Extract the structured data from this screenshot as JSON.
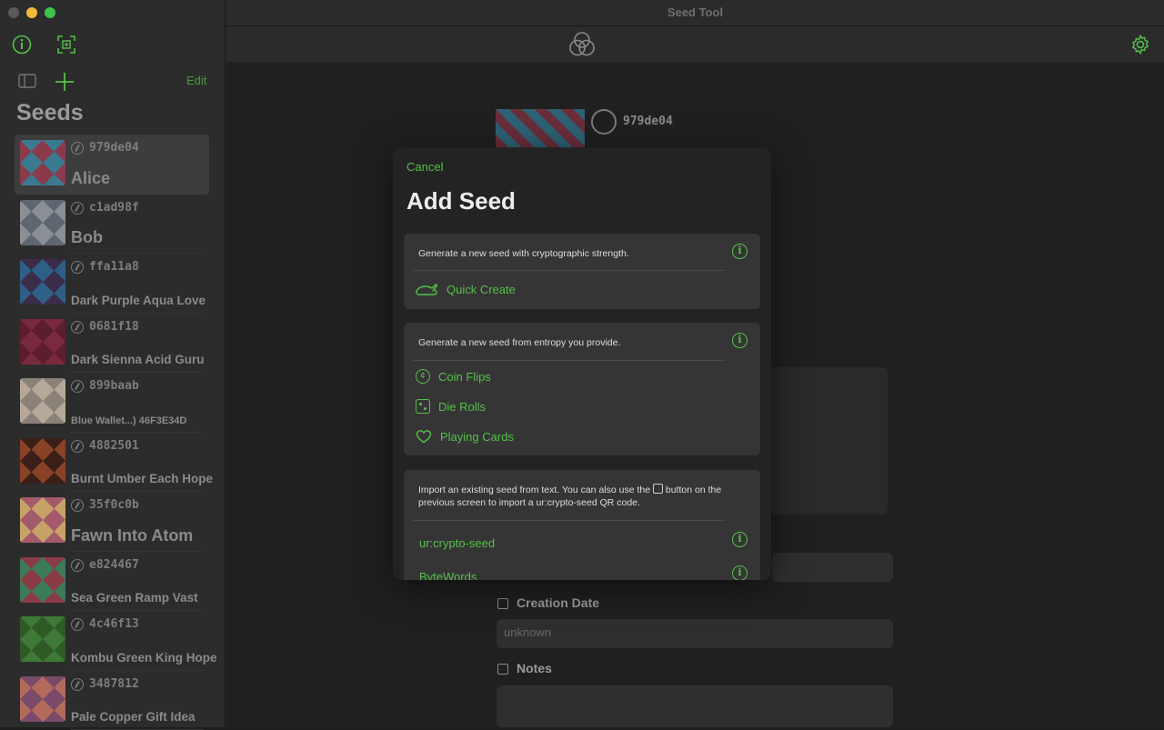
{
  "window": {
    "title": "Seed Tool"
  },
  "sidebar": {
    "title": "Seeds",
    "edit_label": "Edit",
    "seeds": [
      {
        "id": "979de04",
        "name": "Alice",
        "size": "lg",
        "colors": [
          "#8a3a4a",
          "#3a7a90"
        ],
        "selected": true
      },
      {
        "id": "c1ad98f",
        "name": "Bob",
        "size": "lg",
        "colors": [
          "#8a8f96",
          "#5e6670"
        ]
      },
      {
        "id": "ffa11a8",
        "name": "Dark Purple Aqua Love",
        "size": "md",
        "colors": [
          "#2e5f86",
          "#3b2d4a"
        ]
      },
      {
        "id": "0681f18",
        "name": "Dark Sienna Acid Guru",
        "size": "md",
        "colors": [
          "#5c1e2c",
          "#7a2a3e"
        ]
      },
      {
        "id": "899baab",
        "name": "Blue Wallet...) 46F3E34D",
        "size": "sm",
        "colors": [
          "#b6a898",
          "#8a8278"
        ]
      },
      {
        "id": "4882501",
        "name": "Burnt Umber Each Hope",
        "size": "md",
        "colors": [
          "#8a4226",
          "#3a1e18"
        ]
      },
      {
        "id": "35f0c0b",
        "name": "Fawn Into Atom",
        "size": "lg",
        "colors": [
          "#c7a268",
          "#a35a6a"
        ]
      },
      {
        "id": "e824467",
        "name": "Sea Green Ramp Vast",
        "size": "md",
        "colors": [
          "#3c7a5a",
          "#8a3a44"
        ]
      },
      {
        "id": "4c46f13",
        "name": "Kombu Green King Hope",
        "size": "md",
        "colors": [
          "#2e5a26",
          "#3e7a36"
        ]
      },
      {
        "id": "3487812",
        "name": "Pale Copper Gift Idea",
        "size": "md",
        "colors": [
          "#b36a5a",
          "#7a4a6a"
        ]
      }
    ]
  },
  "detail": {
    "seed_id": "979de04",
    "creation_date_label": "Creation Date",
    "creation_date_value": "unknown",
    "notes_label": "Notes"
  },
  "modal": {
    "cancel_label": "Cancel",
    "title": "Add Seed",
    "card1": {
      "description": "Generate a new seed with cryptographic strength.",
      "option": "Quick Create"
    },
    "card2": {
      "description": "Generate a new seed from entropy you provide.",
      "options": [
        "Coin Flips",
        "Die Rolls",
        "Playing Cards"
      ]
    },
    "card3": {
      "description_before": "Import an existing seed from text. You can also use the ",
      "description_after": " button on the previous screen to import a ur:crypto-seed QR code.",
      "options": [
        "ur:crypto-seed",
        "ByteWords"
      ]
    }
  },
  "colors": {
    "accent": "#55c04a",
    "modal_bg": "#232323",
    "card_bg": "#353535"
  }
}
